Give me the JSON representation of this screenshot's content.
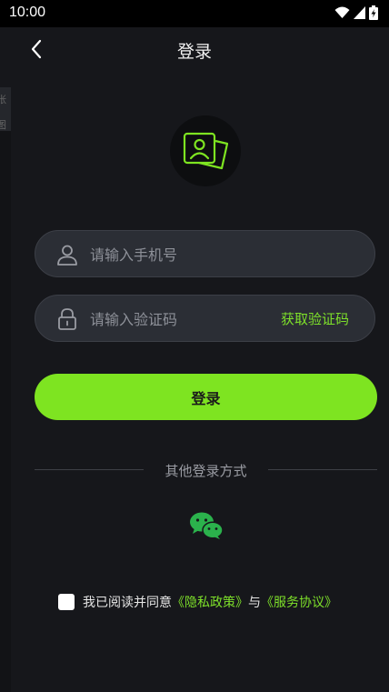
{
  "status_bar": {
    "time": "10:00"
  },
  "side_strip_text": "张图",
  "header": {
    "title": "登录"
  },
  "form": {
    "phone_placeholder": "请输入手机号",
    "code_placeholder": "请输入验证码",
    "get_code_label": "获取验证码",
    "login_label": "登录"
  },
  "other_login": {
    "label": "其他登录方式",
    "wechat_icon": "wechat-icon"
  },
  "agreement": {
    "prefix": "我已阅读并同意",
    "privacy_link": "《隐私政策》",
    "conjunction": "与",
    "service_link": "《服务协议》",
    "checked": false
  },
  "colors": {
    "accent": "#7ee421",
    "background": "#16171b",
    "field": "#2b2e35"
  }
}
